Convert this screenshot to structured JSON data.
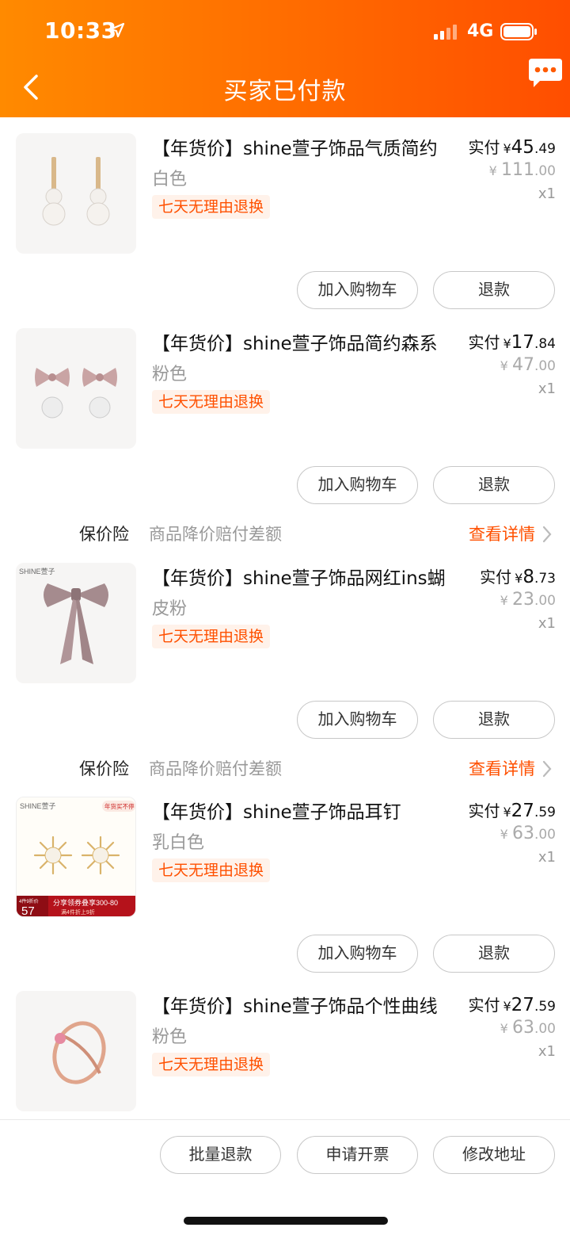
{
  "status_bar": {
    "time": "10:33",
    "network": "4G"
  },
  "header": {
    "title": "买家已付款"
  },
  "items": [
    {
      "name": "【年货价】shine萱子饰品气质简约",
      "spec": "白色",
      "tag": "七天无理由退换",
      "paid_label": "实付",
      "currency": "¥",
      "paid_int": "45",
      "paid_dec": ".49",
      "orig_int": "111",
      "orig_dec": ".00",
      "qty": "x1",
      "cart_label": "加入购物车",
      "refund_label": "退款"
    },
    {
      "name": "【年货价】shine萱子饰品简约森系",
      "spec": "粉色",
      "tag": "七天无理由退换",
      "paid_label": "实付",
      "currency": "¥",
      "paid_int": "17",
      "paid_dec": ".84",
      "orig_int": "47",
      "orig_dec": ".00",
      "qty": "x1",
      "cart_label": "加入购物车",
      "refund_label": "退款"
    },
    {
      "name": "【年货价】shine萱子饰品网红ins蝴",
      "spec": "皮粉",
      "tag": "七天无理由退换",
      "paid_label": "实付",
      "currency": "¥",
      "paid_int": "8",
      "paid_dec": ".73",
      "orig_int": "23",
      "orig_dec": ".00",
      "qty": "x1",
      "cart_label": "加入购物车",
      "refund_label": "退款",
      "thumb_brand": "SHINE萱子"
    },
    {
      "name": "【年货价】shine萱子饰品耳钉",
      "spec": "乳白色",
      "tag": "七天无理由退换",
      "paid_label": "实付",
      "currency": "¥",
      "paid_int": "27",
      "paid_dec": ".59",
      "orig_int": "63",
      "orig_dec": ".00",
      "qty": "x1",
      "cart_label": "加入购物车",
      "refund_label": "退款",
      "thumb_brand": "SHINE萱子",
      "thumb_badge": "年货买不停",
      "thumb_price": "57",
      "thumb_promo": "分享领券叠享300-80",
      "thumb_promo2": "满4件折上9折",
      "thumb_tag": "4件9折价"
    },
    {
      "name": "【年货价】shine萱子饰品个性曲线",
      "spec": "粉色",
      "tag": "七天无理由退换",
      "paid_label": "实付",
      "currency": "¥",
      "paid_int": "27",
      "paid_dec": ".59",
      "orig_int": "63",
      "orig_dec": ".00",
      "qty": "x1"
    }
  ],
  "insurance": {
    "title": "保价险",
    "desc": "商品降价赔付差额",
    "link": "查看详情"
  },
  "bottom_bar": {
    "batch_refund": "批量退款",
    "invoice": "申请开票",
    "change_address": "修改地址"
  },
  "colors": {
    "header_start": "#ff8a00",
    "header_end": "#ff4e00",
    "accent": "#ff5000"
  }
}
